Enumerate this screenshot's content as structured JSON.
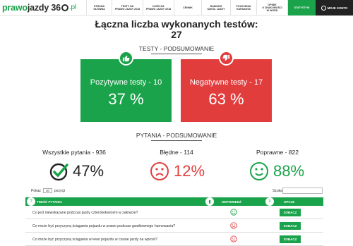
{
  "nav": {
    "logo": {
      "part1": "prawo",
      "part2": "jazdy 36",
      "part3": ".pl"
    },
    "items": [
      {
        "label": "STRONA\nGŁÓWNA"
      },
      {
        "label": "TESTY NA\nPRAWO JAZDY 2018"
      },
      {
        "label": "KURS NA\nPRAWO JAZDY 2018"
      },
      {
        "label": "CENNIK"
      },
      {
        "label": "RANKING\nSZKÓŁ JAZDY"
      },
      {
        "label": "POLECENIA\nKURSANTA"
      },
      {
        "label": "OPINIE\nO ZNAKOMOŚCI\nW WORD"
      },
      {
        "label": "STATYSTYKI"
      }
    ],
    "account_label": "MOJE KONTO"
  },
  "header": {
    "title": "Łączna liczba wykonanych testów:",
    "count": "27"
  },
  "tests_summary": {
    "heading": "TESTY - PODSUMOWANIE",
    "positive": {
      "label": "Pozytywne testy - 10",
      "value": "37 %"
    },
    "negative": {
      "label": "Negatywne testy - 17",
      "value": "63 %"
    }
  },
  "questions_summary": {
    "heading": "PYTANIA - PODSUMOWANIE",
    "all": {
      "label": "Wszystkie pytania - 936",
      "value": "47%"
    },
    "wrong": {
      "label": "Błędne - 114",
      "value": "12%"
    },
    "correct": {
      "label": "Poprawne - 822",
      "value": "88%"
    }
  },
  "colors": {
    "green": "#1aa34a",
    "red": "#e23d3d",
    "dark": "#222222"
  },
  "table": {
    "show_prefix": "Pokaż",
    "show_value": "10",
    "show_suffix": "pozycji",
    "search_label": "Szukaj:",
    "columns": {
      "question": "TREŚĆ PYTANIA",
      "answer": "ODPOWIEDŹ",
      "options": "OPCJE"
    },
    "rows": [
      {
        "text": "Co jest niewskazane podczas jazdy czterokołowcem w zakręcie?",
        "result": "good",
        "button": "ZOBACZ"
      },
      {
        "text": "Co może być przyczyną ściągania pojazdu w prawo podczas gwałtownego hamowania?",
        "result": "bad",
        "button": "ZOBACZ"
      },
      {
        "text": "Co może być przyczyną ściągania w lewo pojazdu w czasie jazdy na wprost?",
        "result": "bad",
        "button": "ZOBACZ"
      }
    ]
  }
}
